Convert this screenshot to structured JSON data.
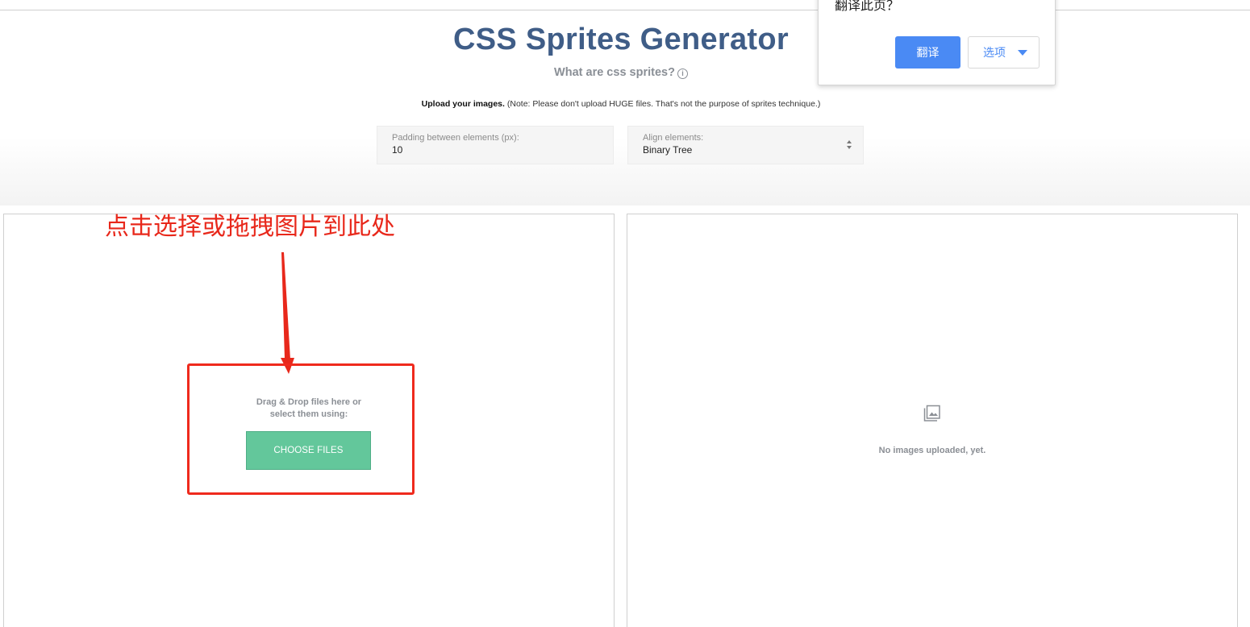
{
  "header": {
    "title": "CSS Sprites Generator",
    "subtitle": "What are css sprites?",
    "info_icon_glyph": "i",
    "upload_bold": "Upload your images.",
    "upload_note": " (Note: Please don't upload HUGE files. That's not the purpose of sprites technique.)"
  },
  "settings": {
    "padding": {
      "label": "Padding between elements (px):",
      "value": "10"
    },
    "align": {
      "label": "Align elements:",
      "value": "Binary Tree"
    }
  },
  "annotation": {
    "text": "点击选择或拖拽图片到此处",
    "color": "#e8281b"
  },
  "upload_panel": {
    "drop_text_line1": "Drag & Drop files here or",
    "drop_text_line2": "select them using:",
    "choose_button": "CHOOSE FILES",
    "button_color": "#63c79b"
  },
  "preview_panel": {
    "icon": "gallery-icon",
    "empty_text": "No images uploaded, yet."
  },
  "translate_popup": {
    "question": "翻译此页？",
    "translate_button": "翻译",
    "options_button": "选项",
    "accent_color": "#4a8af4"
  }
}
